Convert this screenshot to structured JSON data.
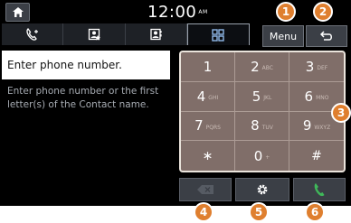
{
  "status_bar": {
    "time": "12:00",
    "ampm": "AM"
  },
  "header": {
    "menu_label": "Menu"
  },
  "tabs": [
    {
      "name": "call-history",
      "icon": "call-history-icon",
      "active": false
    },
    {
      "name": "favorites",
      "icon": "favorite-contact-icon",
      "active": false
    },
    {
      "name": "contacts",
      "icon": "contacts-icon",
      "active": false
    },
    {
      "name": "dial-pad",
      "icon": "dial-pad-icon",
      "active": true
    }
  ],
  "phone_input": {
    "placeholder": "Enter phone number."
  },
  "hint": "Enter phone number or the first letter(s) of the Contact name.",
  "keypad": {
    "keys": [
      {
        "main": "1",
        "sub": ""
      },
      {
        "main": "2",
        "sub": "ABC"
      },
      {
        "main": "3",
        "sub": "DEF"
      },
      {
        "main": "4",
        "sub": "GHI"
      },
      {
        "main": "5",
        "sub": "JKL"
      },
      {
        "main": "6",
        "sub": "MNO"
      },
      {
        "main": "7",
        "sub": "PQRS"
      },
      {
        "main": "8",
        "sub": "TUV"
      },
      {
        "main": "9",
        "sub": "WXYZ"
      },
      {
        "main": "∗",
        "sub": ""
      },
      {
        "main": "0",
        "sub": "+"
      },
      {
        "main": "#",
        "sub": ""
      }
    ]
  },
  "callouts": [
    "1",
    "2",
    "3",
    "4",
    "5",
    "6"
  ],
  "colors": {
    "keypad": "#806e69",
    "callout": "#df7f2f",
    "call_green": "#3fb85a"
  }
}
